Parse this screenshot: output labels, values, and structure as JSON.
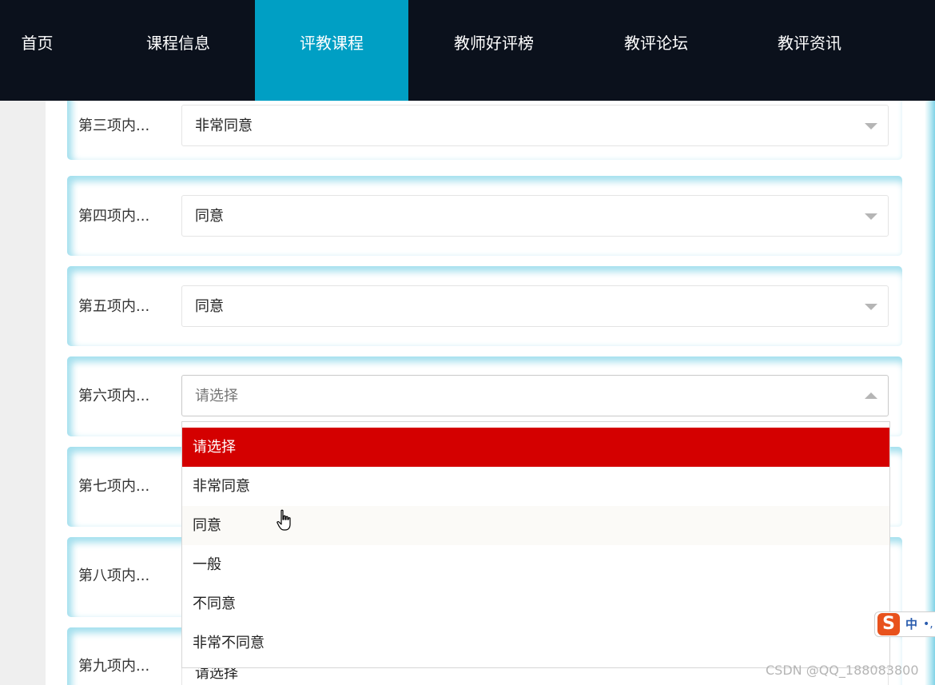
{
  "nav": {
    "items": [
      {
        "label": "首页"
      },
      {
        "label": "课程信息"
      },
      {
        "label": "评教课程",
        "active": true
      },
      {
        "label": "教师好评榜"
      },
      {
        "label": "教评论坛"
      },
      {
        "label": "教评资讯"
      }
    ],
    "active_color": "#009fc4",
    "bg_color": "#0b111c"
  },
  "form": {
    "rows": [
      {
        "label": "第三项内...",
        "value": "非常同意"
      },
      {
        "label": "第四项内...",
        "value": "同意"
      },
      {
        "label": "第五项内...",
        "value": "同意"
      },
      {
        "label": "第六项内...",
        "value": "请选择",
        "state": "open"
      },
      {
        "label": "第七项内...",
        "value": ""
      },
      {
        "label": "第八项内...",
        "value": ""
      },
      {
        "label": "第九项内...",
        "value": "请选择"
      }
    ]
  },
  "dropdown": {
    "options": [
      {
        "label": "请选择",
        "state": "selected"
      },
      {
        "label": "非常同意"
      },
      {
        "label": "同意",
        "state": "hover"
      },
      {
        "label": "一般"
      },
      {
        "label": "不同意"
      },
      {
        "label": "非常不同意"
      }
    ],
    "selected_color": "#d40000"
  },
  "ime": {
    "logo": "S",
    "lang": "中",
    "extra": "•,"
  },
  "watermark": "CSDN @QQ_188083800",
  "cursor": "hand-pointer-icon"
}
